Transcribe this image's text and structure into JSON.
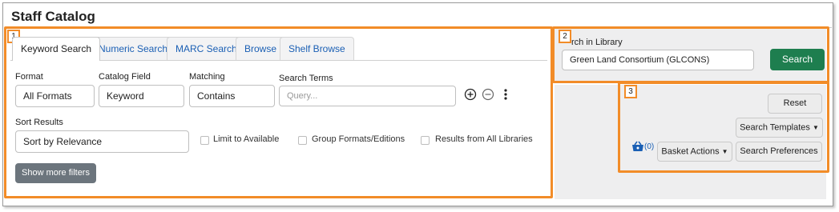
{
  "page": {
    "title": "Staff Catalog"
  },
  "callouts": [
    "1",
    "2",
    "3"
  ],
  "tabs": [
    "Keyword Search",
    "Numeric Search",
    "MARC Search",
    "Browse",
    "Shelf Browse"
  ],
  "search_row": {
    "format_label": "Format",
    "format_value": "All Formats",
    "field_label": "Catalog Field",
    "field_value": "Keyword",
    "matching_label": "Matching",
    "matching_value": "Contains",
    "terms_label": "Search Terms",
    "terms_placeholder": "Query..."
  },
  "sort": {
    "label": "Sort Results",
    "value": "Sort by Relevance"
  },
  "filters": {
    "limit_available": "Limit to Available",
    "group_formats": "Group Formats/Editions",
    "all_libraries": "Results from All Libraries"
  },
  "more_filters_label": "Show more filters",
  "library": {
    "label": "rch in Library",
    "value": "Green Land Consortium (GLCONS)",
    "search_label": "Search"
  },
  "actions": {
    "reset": "Reset",
    "templates": "Search Templates",
    "basket_count": "(0)",
    "basket_actions": "Basket Actions",
    "preferences": "Search Preferences"
  },
  "colors": {
    "callout": "#f28c28",
    "search_button": "#1e7e4f",
    "link": "#1a5fb4"
  }
}
